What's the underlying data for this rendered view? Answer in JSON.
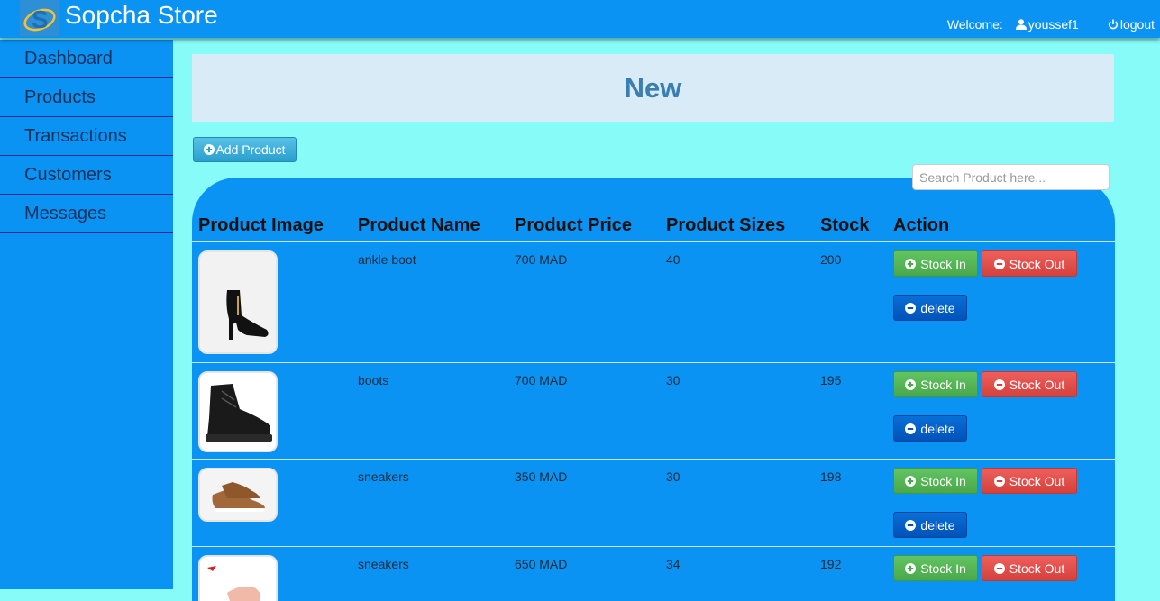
{
  "app": {
    "brand": "Sopcha Store"
  },
  "topbar": {
    "welcome_label": "Welcome:",
    "username": "youssef1",
    "logout_label": "logout"
  },
  "sidebar": {
    "items": [
      {
        "label": "Dashboard"
      },
      {
        "label": "Products"
      },
      {
        "label": "Transactions"
      },
      {
        "label": "Customers"
      },
      {
        "label": "Messages"
      }
    ]
  },
  "page": {
    "title": "New",
    "add_button": "Add Product",
    "search_placeholder": "Search Product here..."
  },
  "table": {
    "columns": [
      "Product Image",
      "Product Name",
      "Product Price",
      "Product Sizes",
      "Stock",
      "Action"
    ],
    "actions": {
      "stock_in": "Stock In",
      "stock_out": "Stock Out",
      "delete": "delete"
    },
    "rows": [
      {
        "name": "ankle boot",
        "price": "700 MAD",
        "sizes": "40",
        "stock": "200",
        "image_icon": "ankle-boot-icon"
      },
      {
        "name": "boots",
        "price": "700 MAD",
        "sizes": "30",
        "stock": "195",
        "image_icon": "boot-icon"
      },
      {
        "name": "sneakers",
        "price": "350 MAD",
        "sizes": "30",
        "stock": "198",
        "image_icon": "sneaker-brown-icon"
      },
      {
        "name": "sneakers",
        "price": "650 MAD",
        "sizes": "34",
        "stock": "192",
        "image_icon": "sneaker-pink-icon"
      }
    ]
  },
  "colors": {
    "topbar": "#0b93f3",
    "background": "#87fbf8",
    "header_panel": "#d8ebf7",
    "title": "#3a7fb0",
    "stock_in": "#5cb85c",
    "stock_out": "#d9534f",
    "delete": "#0060c8"
  }
}
